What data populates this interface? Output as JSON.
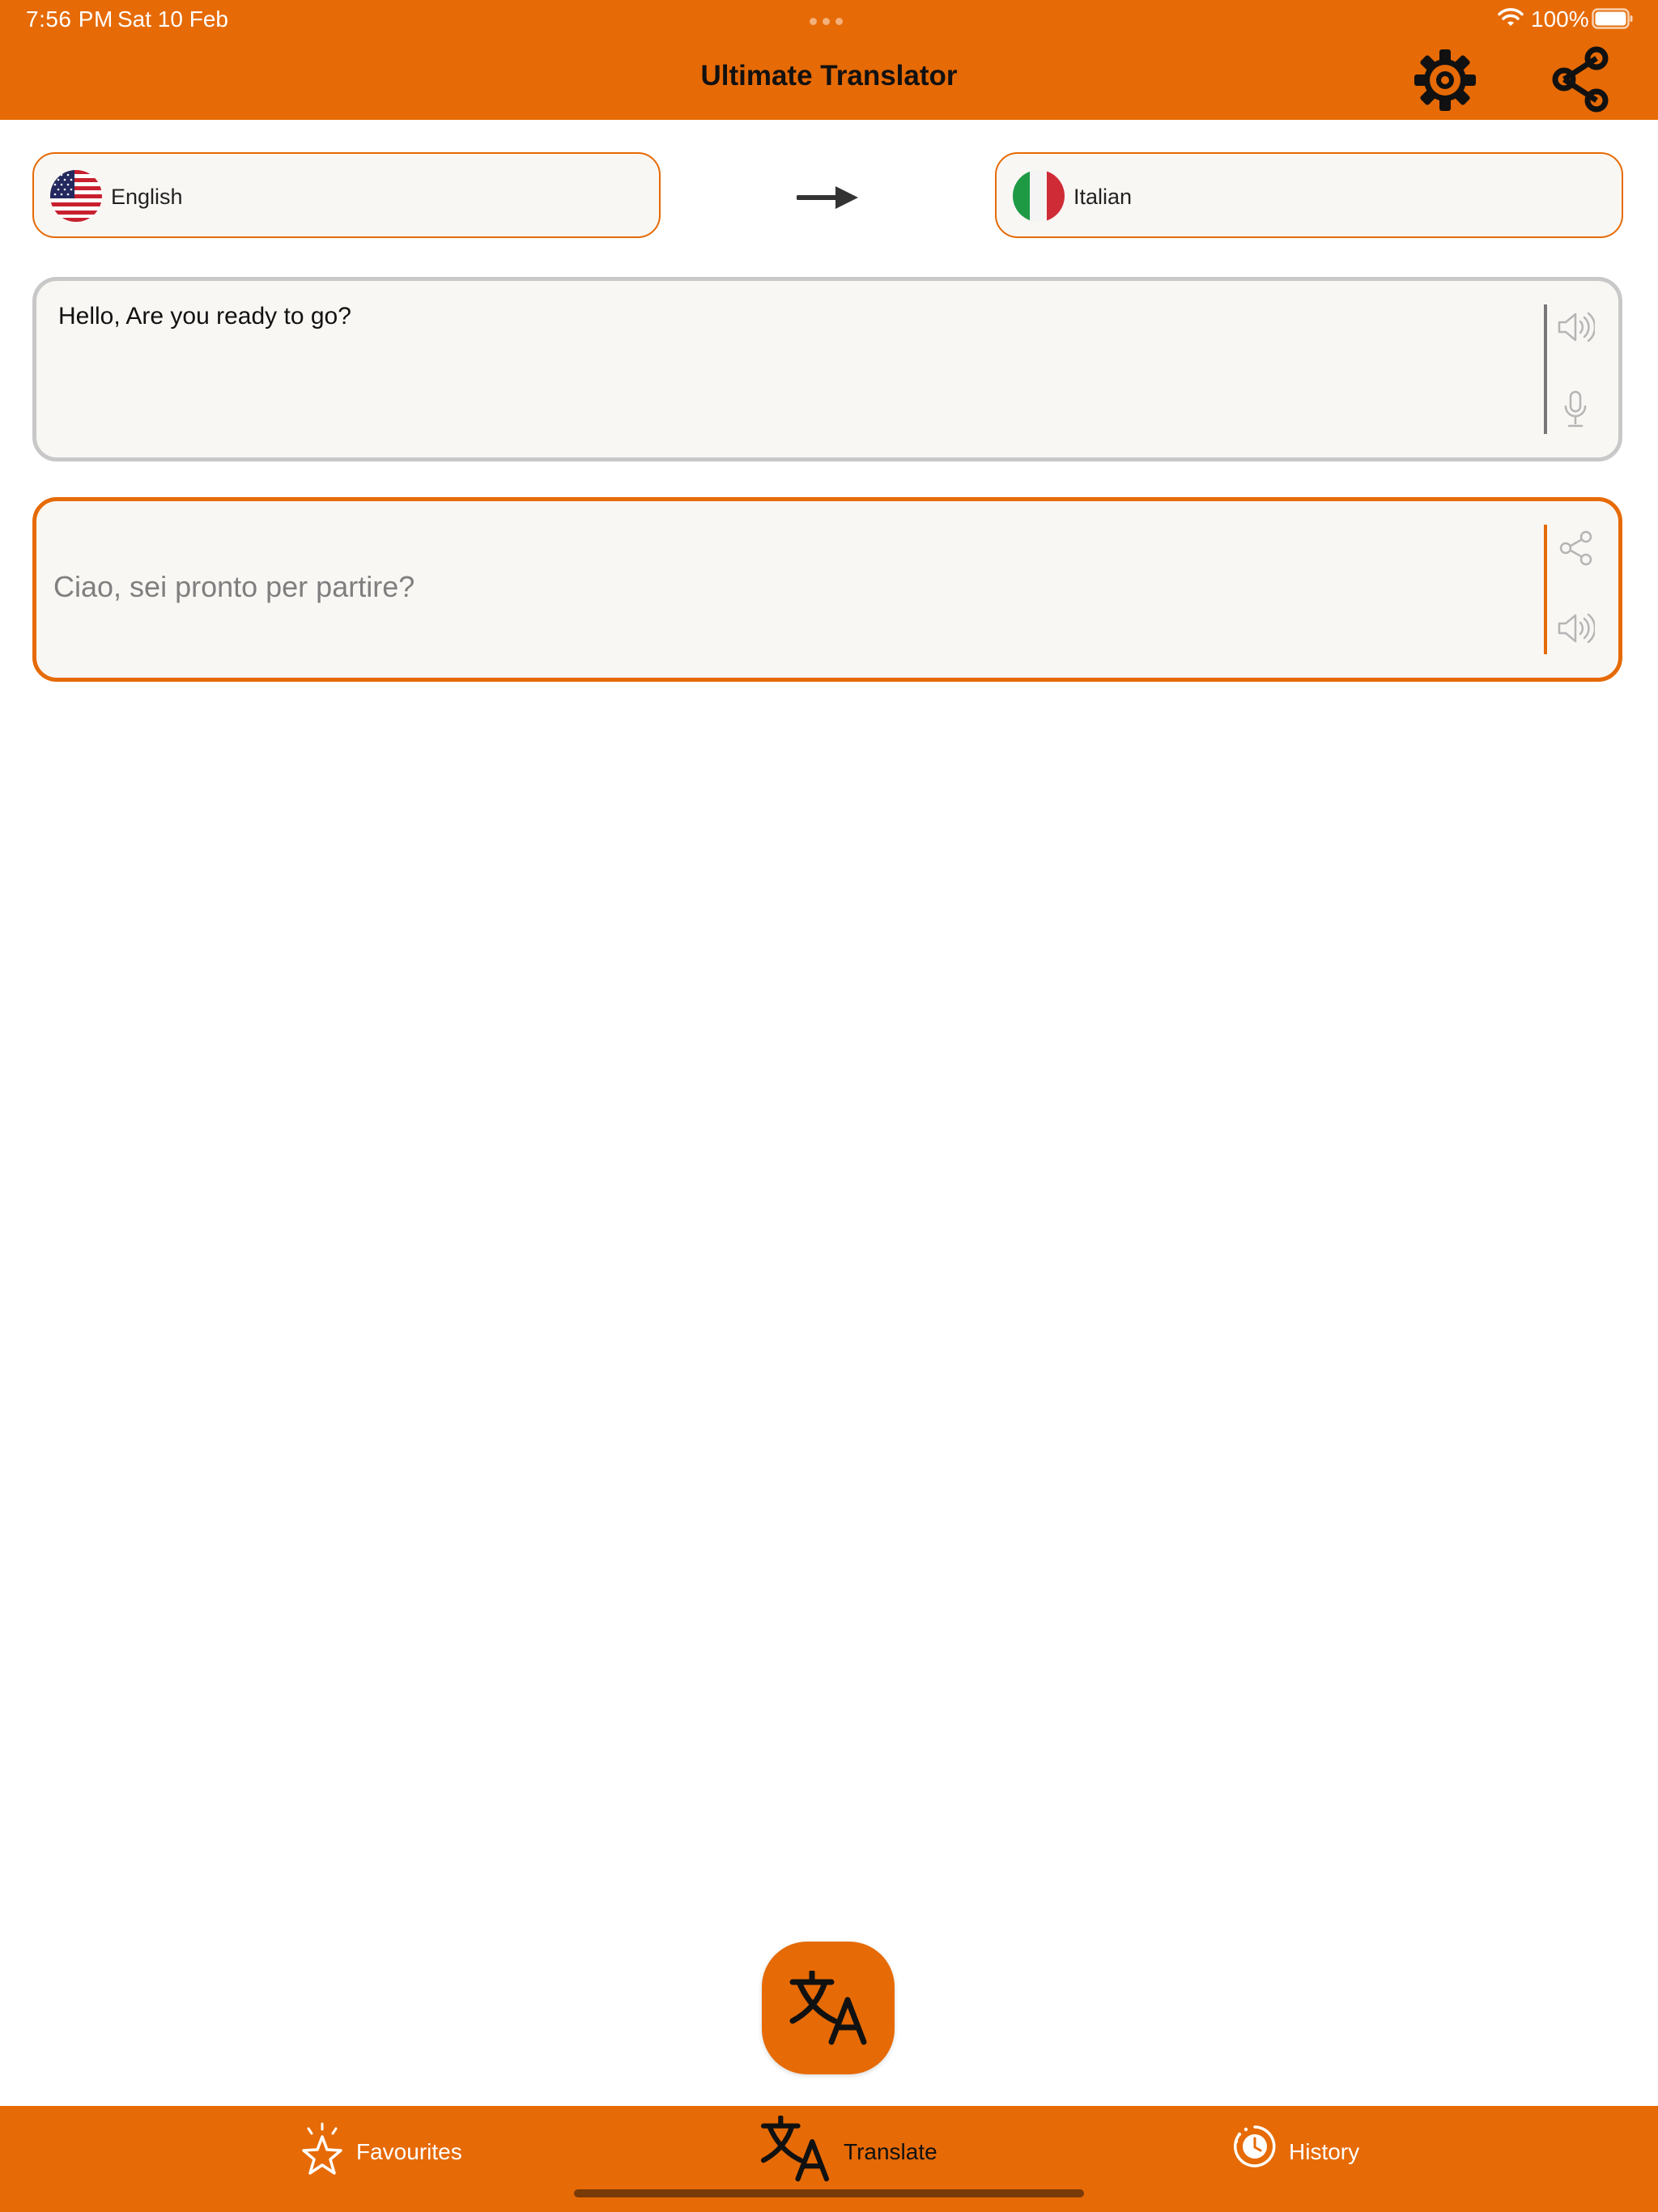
{
  "status_bar": {
    "time": "7:56 PM",
    "date": "Sat 10 Feb",
    "battery": "100%"
  },
  "header": {
    "title": "Ultimate Translator",
    "settings_icon": "gear-icon",
    "share_icon": "share-icon"
  },
  "languages": {
    "source": {
      "label": "English",
      "flag": "us-flag-icon"
    },
    "target": {
      "label": "Italian",
      "flag": "italy-flag-icon"
    },
    "swap_icon": "arrow-right-icon"
  },
  "input": {
    "text": "Hello, Are you ready to go?",
    "icons": [
      "speaker-icon",
      "microphone-icon"
    ]
  },
  "output": {
    "text": "Ciao, sei pronto per partire?",
    "icons": [
      "share-icon",
      "speaker-icon"
    ]
  },
  "tabs": [
    {
      "label": "Favourites",
      "icon": "star-icon",
      "active": false
    },
    {
      "label": "Translate",
      "icon": "translate-icon",
      "active": true
    },
    {
      "label": "History",
      "icon": "history-clock-icon",
      "active": false
    }
  ],
  "colors": {
    "accent": "#e66a05",
    "active_tab_text": "#111111",
    "inactive_tab_text": "#ffffff",
    "output_text": "#7f7f7f"
  }
}
